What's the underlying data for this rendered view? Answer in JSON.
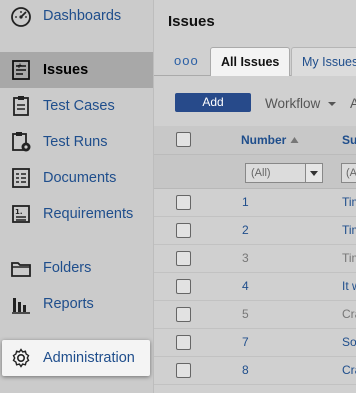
{
  "sidebar": {
    "items": [
      {
        "label": "Dashboards",
        "icon": "dashboard-gauge-icon"
      },
      {
        "label": "Issues",
        "icon": "issues-list-icon"
      },
      {
        "label": "Test Cases",
        "icon": "clipboard-icon"
      },
      {
        "label": "Test Runs",
        "icon": "test-run-icon"
      },
      {
        "label": "Documents",
        "icon": "document-icon"
      },
      {
        "label": "Requirements",
        "icon": "requirements-icon"
      },
      {
        "label": "Folders",
        "icon": "folder-icon"
      },
      {
        "label": "Reports",
        "icon": "bar-chart-icon"
      },
      {
        "label": "Administration",
        "icon": "gear-icon"
      }
    ]
  },
  "main": {
    "title": "Issues",
    "tabs": [
      {
        "label": "All Issues"
      },
      {
        "label": "My Issues"
      }
    ],
    "more_icon": "ooo",
    "toolbar": {
      "add_label": "Add",
      "workflow_label": "Workflow",
      "extra_label": "A"
    },
    "grid": {
      "columns": [
        {
          "label": "Number"
        },
        {
          "label": "Su"
        }
      ],
      "filters": [
        {
          "value": "(All)"
        },
        {
          "value": "(A"
        }
      ],
      "rows": [
        {
          "number": "1",
          "summary": "Tim",
          "status": "open"
        },
        {
          "number": "2",
          "summary": "Tim",
          "status": "open"
        },
        {
          "number": "3",
          "summary": "Tim",
          "status": "closed"
        },
        {
          "number": "4",
          "summary": "It w",
          "status": "open"
        },
        {
          "number": "5",
          "summary": "Cra",
          "status": "closed"
        },
        {
          "number": "7",
          "summary": "So",
          "status": "open"
        },
        {
          "number": "8",
          "summary": "Cra",
          "status": "open"
        }
      ]
    }
  },
  "colors": {
    "sidebar_bg": "#cbcbcb",
    "link_blue": "#1f4e8c",
    "active_item_bg": "#a8a8a8",
    "add_button": "#274a8a"
  }
}
